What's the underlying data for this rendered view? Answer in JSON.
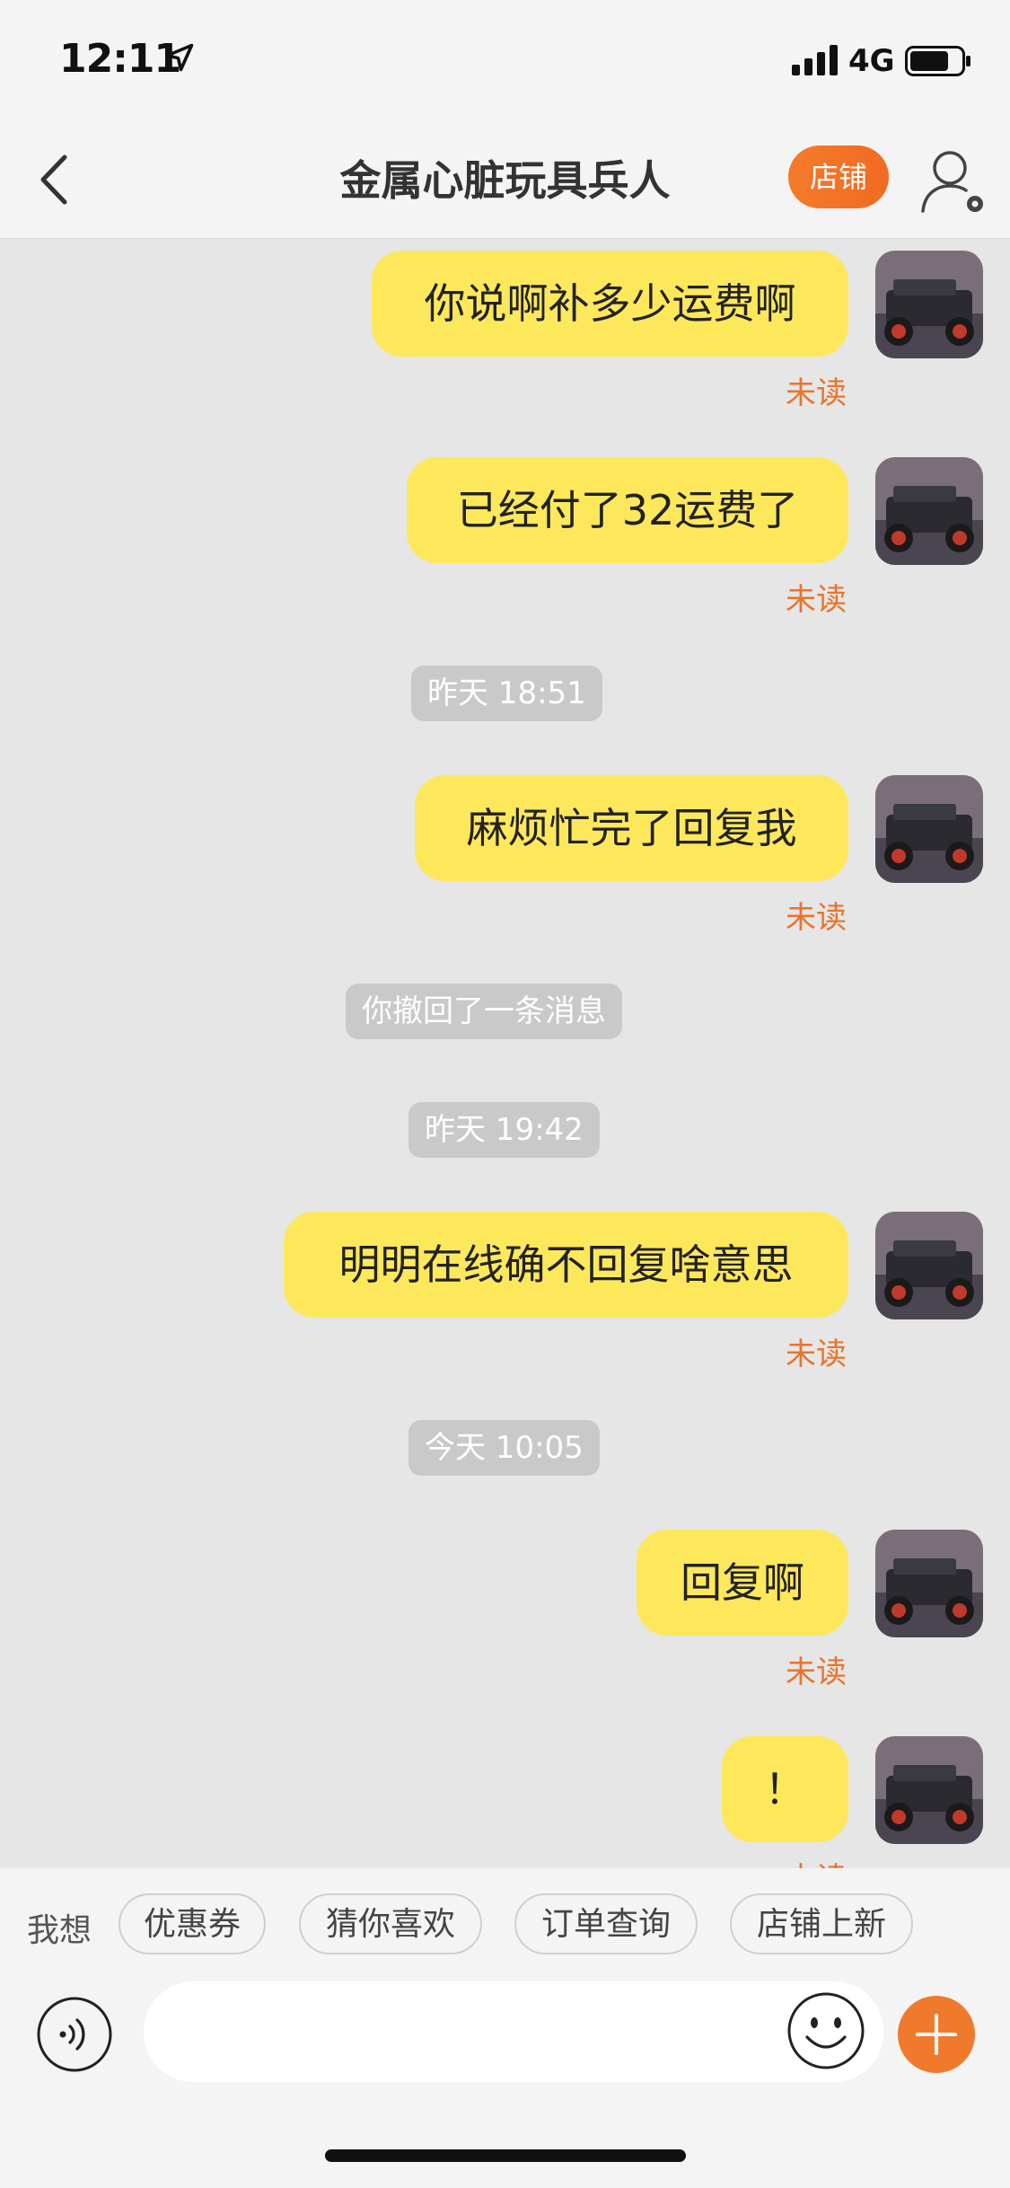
{
  "status_bar": {
    "time": "12:11",
    "network": "4G"
  },
  "header": {
    "title": "金属心脏玩具兵人",
    "shop_label": "店铺"
  },
  "messages": [
    {
      "text": "你说啊补多少运费啊",
      "status": "未读"
    },
    {
      "text": "已经付了32运费了",
      "status": "未读"
    },
    {
      "timestamp": "昨天 18:51"
    },
    {
      "text": "麻烦忙完了回复我",
      "status": "未读"
    },
    {
      "system": "你撤回了一条消息"
    },
    {
      "timestamp": "昨天 19:42"
    },
    {
      "text": "明明在线确不回复啥意思",
      "status": "未读"
    },
    {
      "timestamp": "今天 10:05"
    },
    {
      "text": "回复啊",
      "status": "未读"
    },
    {
      "text": "！",
      "status": "未读"
    }
  ],
  "quick_bar": {
    "label": "我想",
    "chips": [
      "优惠券",
      "猜你喜欢",
      "订单查询",
      "店铺上新"
    ]
  },
  "input": {
    "placeholder": ""
  },
  "colors": {
    "bubble": "#fde85c",
    "accent": "#f07a2c",
    "unread": "#e8742c"
  },
  "icons": [
    "location-arrow-icon",
    "signal-icon",
    "battery-icon",
    "back-chevron-icon",
    "user-settings-icon",
    "voice-icon",
    "emoji-icon",
    "plus-icon"
  ]
}
